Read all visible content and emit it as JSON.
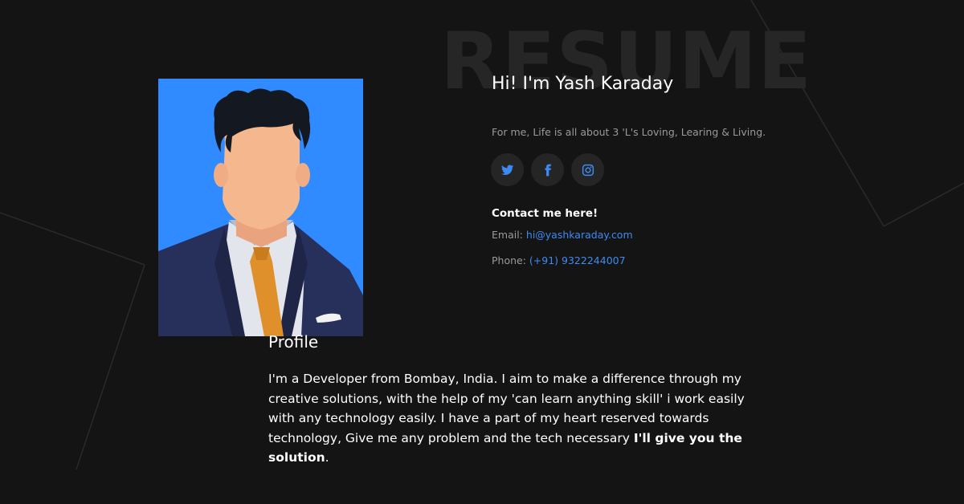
{
  "watermark": "RESUME",
  "hero": {
    "greeting": "Hi! I'm Yash Karaday",
    "tagline": "For me, Life is all about 3 'L's Loving, Learing & Living."
  },
  "socials": [
    {
      "icon": "twitter-icon"
    },
    {
      "icon": "facebook-icon"
    },
    {
      "icon": "instagram-icon"
    }
  ],
  "contact": {
    "heading": "Contact me here!",
    "email_label": "Email:",
    "email": "hi@yashkaraday.com",
    "phone_label": "Phone:",
    "phone": "(+91) 9322244007"
  },
  "profile": {
    "title": "Profile",
    "body": "I'm a Developer from Bombay, India. I aim to make a difference through my creative solutions, with the help of my 'can learn anything skill' i work easily with any technology easily. I have a part of my heart reserved towards technology, Give me any problem and the tech necessary ",
    "body_bold": "I'll give you the solution",
    "body_end": "."
  },
  "colors": {
    "background": "#141414",
    "accent": "#3d8bf2",
    "avatar_background": "#2f8bff",
    "muted_text": "#9a9a9a",
    "icon_circle": "#252525"
  }
}
